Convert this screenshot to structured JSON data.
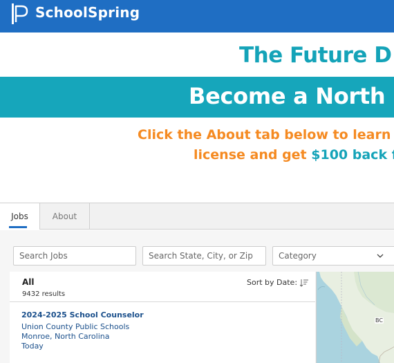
{
  "header": {
    "brand": "SchoolSpring",
    "logo_icon": "schoolspring-p-logo-icon"
  },
  "banner": {
    "line1": "The Future D",
    "line2": "Become a North",
    "line3": "Click the About tab below to learn n",
    "line4_prefix": "license and get ",
    "line4_highlight": "$100 back f",
    "colors": {
      "teal": "#16a6bb",
      "orange": "#f58a21"
    }
  },
  "tabs": [
    {
      "label": "Jobs",
      "active": true
    },
    {
      "label": "About",
      "active": false
    }
  ],
  "filters": {
    "search_jobs_placeholder": "Search Jobs",
    "location_placeholder": "Search State, City, or Zip",
    "category_placeholder": "Category"
  },
  "results": {
    "filter_label": "All",
    "count": "9432 results",
    "sort_label": "Sort by Date:",
    "sort_icon": "sort-descending-icon"
  },
  "jobs": [
    {
      "title": "2024-2025 School Counselor",
      "district": "Union County Public Schools",
      "location": "Monroe, North Carolina",
      "posted": "Today"
    }
  ],
  "map": {
    "region_label": "BC"
  },
  "colors": {
    "header": "#1f6ec3",
    "link": "#1a4f8b"
  }
}
